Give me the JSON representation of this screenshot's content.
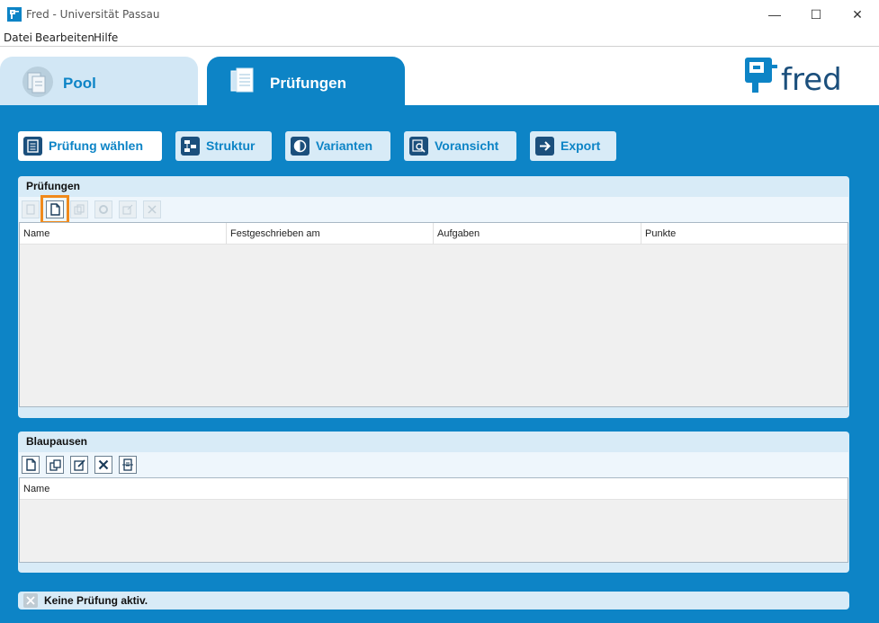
{
  "window": {
    "title": "Fred - Universität Passau",
    "min_glyph": "—",
    "max_glyph": "☐",
    "close_glyph": "✕"
  },
  "menu": [
    "Datei",
    "Bearbeiten",
    "Hilfe"
  ],
  "tabs": [
    {
      "label": "Pool",
      "icon": "pool-icon",
      "active": false
    },
    {
      "label": "Prüfungen",
      "icon": "documents-icon",
      "active": true
    }
  ],
  "logo": {
    "text": "fred"
  },
  "nav_buttons": [
    {
      "label": "Prüfung wählen",
      "icon": "document-icon",
      "active": true
    },
    {
      "label": "Struktur",
      "icon": "structure-icon",
      "active": false
    },
    {
      "label": "Varianten",
      "icon": "contrast-icon",
      "active": false
    },
    {
      "label": "Voransicht",
      "icon": "preview-icon",
      "active": false
    },
    {
      "label": "Export",
      "icon": "arrow-right-icon",
      "active": false
    }
  ],
  "pruefungen_panel": {
    "title": "Prüfungen",
    "toolbar": [
      {
        "icon": "open-icon",
        "enabled": false
      },
      {
        "icon": "new-document-icon",
        "enabled": true,
        "highlighted": true
      },
      {
        "icon": "copy-icon",
        "enabled": false
      },
      {
        "icon": "settings-icon",
        "enabled": false
      },
      {
        "icon": "export-icon",
        "enabled": false
      },
      {
        "icon": "delete-icon",
        "enabled": false
      }
    ],
    "columns": [
      "Name",
      "Festgeschrieben am",
      "Aufgaben",
      "Punkte"
    ],
    "rows": []
  },
  "blaupausen_panel": {
    "title": "Blaupausen",
    "toolbar": [
      {
        "icon": "new-document-icon",
        "enabled": true
      },
      {
        "icon": "copy-icon",
        "enabled": true
      },
      {
        "icon": "edit-icon",
        "enabled": true
      },
      {
        "icon": "delete-icon",
        "enabled": true
      },
      {
        "icon": "convert-icon",
        "enabled": true
      }
    ],
    "columns": [
      "Name"
    ],
    "rows": []
  },
  "status": {
    "text": "Keine Prüfung aktiv.",
    "icon": "close-icon"
  },
  "colors": {
    "accent": "#0d84c6",
    "panel": "#d8ebf7",
    "nav_icon": "#1b4f7c",
    "highlight": "#f08a1c"
  }
}
